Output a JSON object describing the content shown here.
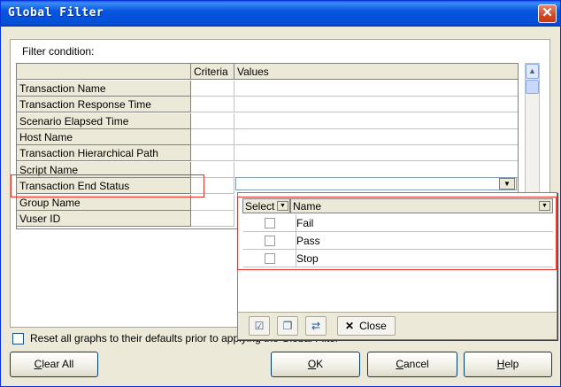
{
  "window": {
    "title": "Global Filter"
  },
  "filter_label": "Filter condition:",
  "grid": {
    "columns": [
      "",
      "Criteria",
      "Values"
    ],
    "rows": [
      "Transaction Name",
      "Transaction Response Time",
      "Scenario Elapsed Time",
      "Host Name",
      "Transaction Hierarchical Path",
      "Script Name",
      "Transaction End Status",
      "Group Name",
      "Vuser ID"
    ]
  },
  "popup": {
    "select_header": "Select",
    "name_header": "Name",
    "items": [
      {
        "name": "Fail",
        "checked": false
      },
      {
        "name": "Pass",
        "checked": false
      },
      {
        "name": "Stop",
        "checked": false
      }
    ],
    "close_label": "Close"
  },
  "reset": {
    "label": "Reset all graphs to their defaults prior to applying the Global Filter",
    "checked": false
  },
  "buttons": {
    "clear_all": {
      "label_u": "C",
      "label_rest": "lear All"
    },
    "ok": {
      "label_u": "O",
      "label_rest": "K"
    },
    "cancel": {
      "label_u": "C",
      "label_rest": "ancel"
    },
    "help": {
      "label_u": "H",
      "label_rest": "elp"
    }
  },
  "colors": {
    "highlight": "#e8302a",
    "titlebar": "#0654e0"
  }
}
